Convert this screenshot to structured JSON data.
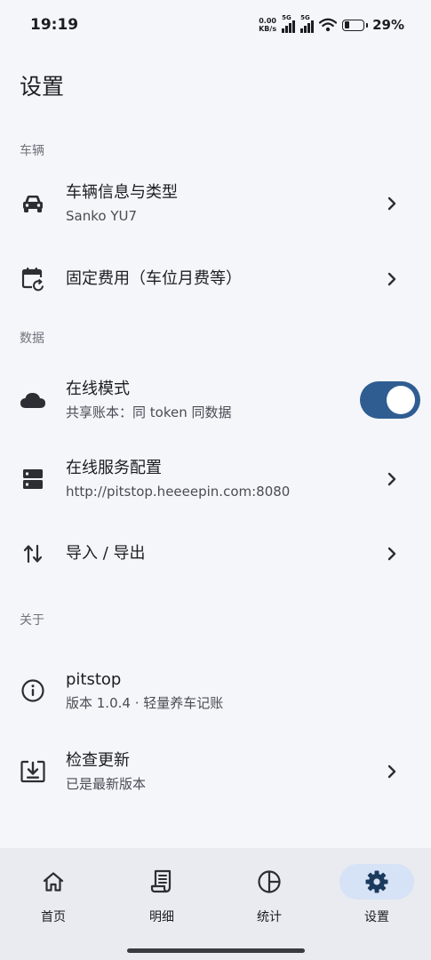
{
  "status_bar": {
    "time": "19:19",
    "net_speed_value": "0.00",
    "net_speed_unit": "KB/s",
    "signal1_tag": "5G",
    "signal2_tag": "5G",
    "battery_level": 0.29,
    "battery_pct": "29%"
  },
  "header": {
    "title": "设置"
  },
  "sections": {
    "vehicle": {
      "title": "车辆",
      "items": [
        {
          "icon": "car-icon",
          "title": "车辆信息与类型",
          "subtitle": "Sanko YU7"
        },
        {
          "icon": "calendar-refresh-icon",
          "title": "固定费用（车位月费等）"
        }
      ]
    },
    "data": {
      "title": "数据",
      "items": [
        {
          "icon": "cloud-icon",
          "title": "在线模式",
          "subtitle": "共享账本：同 token 同数据",
          "toggle_on": true
        },
        {
          "icon": "server-icon",
          "title": "在线服务配置",
          "subtitle": "http://pitstop.heeeepin.com:8080"
        },
        {
          "icon": "import-export-icon",
          "title": "导入 / 导出"
        }
      ]
    },
    "about": {
      "title": "关于",
      "items": [
        {
          "icon": "info-icon",
          "title": "pitstop",
          "subtitle": "版本 1.0.4 · 轻量养车记账"
        },
        {
          "icon": "download-box-icon",
          "title": "检查更新",
          "subtitle": "已是最新版本"
        }
      ]
    }
  },
  "bottom_nav": {
    "items": [
      {
        "icon": "home-icon",
        "label": "首页"
      },
      {
        "icon": "receipt-icon",
        "label": "明细"
      },
      {
        "icon": "pie-chart-icon",
        "label": "统计"
      },
      {
        "icon": "gear-icon",
        "label": "设置",
        "active": true
      }
    ]
  },
  "colors": {
    "accent": "#2f5d91",
    "active_pill": "#d6e2f6",
    "nav_bg": "#e9ebf1",
    "page_bg": "#f5f6fa"
  }
}
